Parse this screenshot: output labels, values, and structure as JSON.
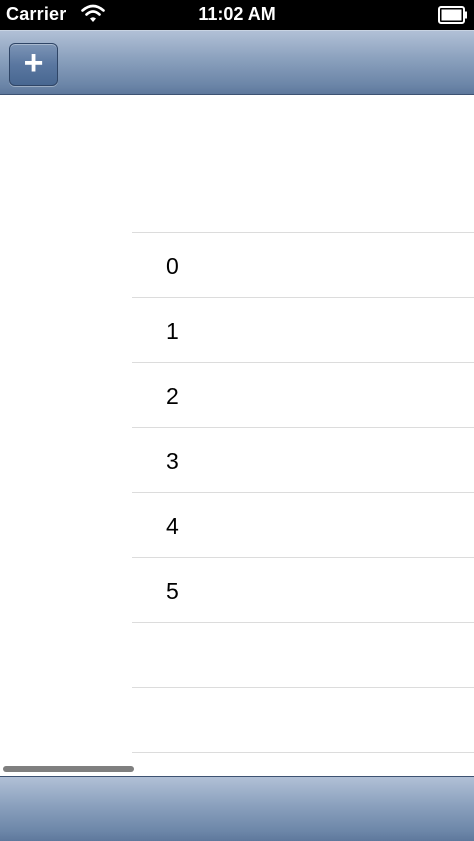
{
  "status_bar": {
    "carrier": "Carrier",
    "time": "11:02 AM",
    "icons": [
      "wifi-icon",
      "battery-icon"
    ]
  },
  "nav_bar": {
    "add_button_label": "+",
    "add_button_icon": "plus-icon"
  },
  "list": {
    "rows": [
      {
        "label": "0"
      },
      {
        "label": "1"
      },
      {
        "label": "2"
      },
      {
        "label": "3"
      },
      {
        "label": "4"
      },
      {
        "label": "5"
      },
      {
        "label": ""
      },
      {
        "label": ""
      }
    ]
  },
  "colors": {
    "bar_gradient_top": "#b1c0d6",
    "bar_gradient_bottom": "#5e789c",
    "separator": "#dcdcdc",
    "status_bar": "#000000"
  }
}
